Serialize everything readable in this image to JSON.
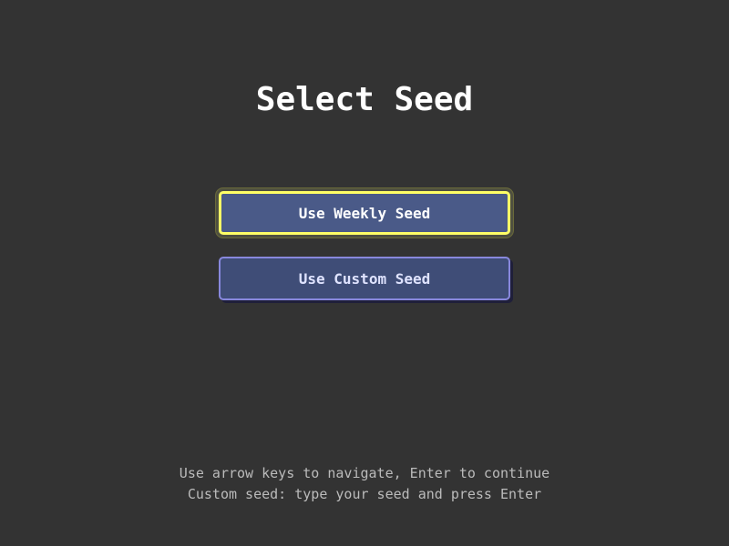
{
  "screen": {
    "title": "Select Seed"
  },
  "menu": {
    "items": [
      {
        "label": "Use Weekly Seed",
        "selected": true
      },
      {
        "label": "Use Custom Seed",
        "selected": false
      }
    ]
  },
  "hints": {
    "line1": "Use arrow keys to navigate, Enter to continue",
    "line2": "Custom seed: type your seed and press Enter"
  },
  "colors": {
    "background": "#333333",
    "button_fill": "#4a5a88",
    "selected_border": "#ffff66",
    "button_border": "#8888dd",
    "hint_text": "#bbbbbb"
  }
}
